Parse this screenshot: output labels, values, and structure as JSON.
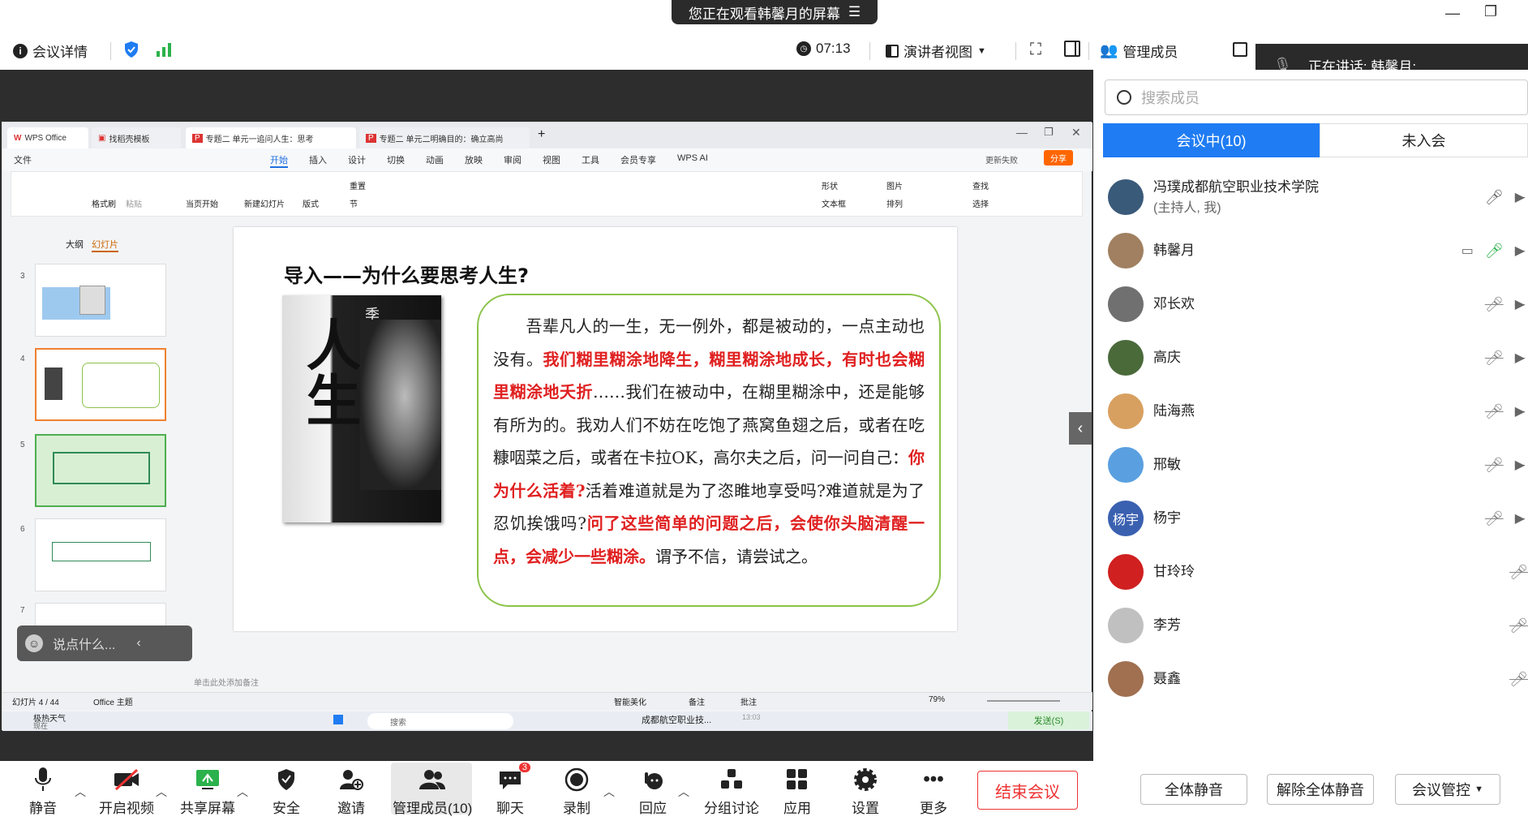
{
  "banner": {
    "text": "您正在观看韩馨月的屏幕"
  },
  "topbar": {
    "meeting_details": "会议详情",
    "timer": "07:13",
    "view_mode": "演讲者视图",
    "manage_members": "管理成员"
  },
  "speaking": {
    "label": "正在讲话:",
    "name": "韩馨月;"
  },
  "wps": {
    "tabs": [
      "WPS Office",
      "找稻壳模板",
      "专题二 单元一追问人生：思考",
      "专题二 单元二明确目的：确立高尚"
    ],
    "file_menu": "文件",
    "menus": [
      "开始",
      "插入",
      "设计",
      "切换",
      "动画",
      "放映",
      "审阅",
      "视图",
      "工具",
      "会员专享",
      "WPS AI"
    ],
    "share": "分享",
    "update_fail": "更新失败",
    "ribbon": {
      "format_painter": "格式刷",
      "paste": "粘贴",
      "from_current": "当页开始",
      "new_slide": "新建幻灯片",
      "layout": "版式",
      "reset": "重置",
      "section": "节",
      "shape": "形状",
      "picture": "图片",
      "textbox": "文本框",
      "arrange": "排列",
      "find": "查找",
      "select": "选择"
    },
    "outline_tab": "大纲",
    "slides_tab": "幻灯片",
    "thumb_numbers": [
      "3",
      "4",
      "5",
      "6",
      "7"
    ],
    "notes_placeholder": "单击此处添加备注",
    "status": {
      "slide_count": "幻灯片 4 / 44",
      "theme": "Office 主题",
      "beautify": "智能美化",
      "notes": "备注",
      "comment": "批注",
      "zoom": "79%"
    },
    "chat_placeholder": "说点什么...",
    "taskbar": {
      "weather": "极热天气",
      "weather_sub": "现在",
      "search": "搜索",
      "notif_title": "成都航空职业技...",
      "notif_time": "13:03",
      "send": "发送(S)"
    }
  },
  "slide": {
    "title": "导入——为什么要思考人生?",
    "book_text": "季羡林谈",
    "book_big": "人生",
    "p1": "吾辈凡人的一生，无一例外，都是被动的，一点主动也没有。",
    "r1": "我们糊里糊涂地降生，糊里糊涂地成长，有时也会糊里糊涂地夭折",
    "p2": "……我们在被动中，在糊里糊涂中，还是能够有所为的。我劝人们不妨在吃饱了燕窝鱼翅之后，或者在吃糠咽菜之后，或者在卡拉OK，高尔夫之后，问一问自己：",
    "r2": "你为什么活着?",
    "p3": "活着难道就是为了恣睢地享受吗?难道就是为了忍饥挨饿吗?",
    "r3": "问了这些简单的问题之后，会使你头脑清醒一点，会减少一些糊涂。",
    "p4": "谓予不信，请尝试之。"
  },
  "panel": {
    "search_placeholder": "搜索成员",
    "tab_in": "会议中(10)",
    "tab_out": "未入会",
    "members": [
      {
        "name": "冯璞成都航空职业技术学院",
        "sub": "(主持人, 我)",
        "color": "#3a5a7a"
      },
      {
        "name": "韩馨月",
        "sub": "",
        "color": "#a08060"
      },
      {
        "name": "邓长欢",
        "sub": "",
        "color": "#707070"
      },
      {
        "name": "高庆",
        "sub": "",
        "color": "#4a6a3a"
      },
      {
        "name": "陆海燕",
        "sub": "",
        "color": "#d8a060"
      },
      {
        "name": "邢敏",
        "sub": "",
        "color": "#5aa0e0"
      },
      {
        "name": "杨宇",
        "sub": "",
        "color": "#3a60b0",
        "initials": "杨宇"
      },
      {
        "name": "甘玲玲",
        "sub": "",
        "color": "#d02020"
      },
      {
        "name": "李芳",
        "sub": "",
        "color": "#c0c0c0"
      },
      {
        "name": "聂鑫",
        "sub": "",
        "color": "#a07050"
      }
    ],
    "mute_all": "全体静音",
    "unmute_all": "解除全体静音",
    "meeting_control": "会议管控"
  },
  "toolbar": {
    "mute": "静音",
    "video": "开启视频",
    "share": "共享屏幕",
    "security": "安全",
    "invite": "邀请",
    "members": "管理成员(10)",
    "chat": "聊天",
    "chat_badge": "3",
    "record": "录制",
    "react": "回应",
    "breakout": "分组讨论",
    "apps": "应用",
    "settings": "设置",
    "more": "更多",
    "end": "结束会议"
  },
  "colors": {
    "accent": "#1f7cf2",
    "end": "#e33333",
    "highlight_red": "#e02020",
    "border_green": "#8bc34a"
  }
}
